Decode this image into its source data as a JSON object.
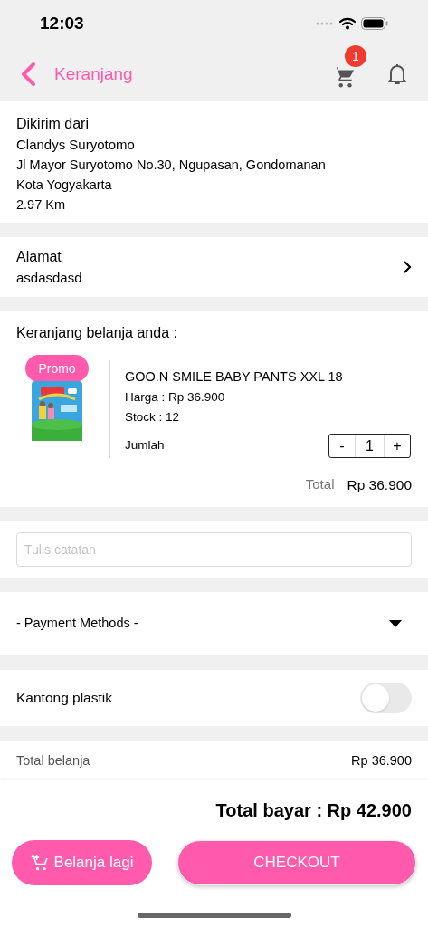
{
  "status_bar": {
    "time": "12:03"
  },
  "header": {
    "title": "Keranjang",
    "cart_badge": "1"
  },
  "sender": {
    "heading": "Dikirim dari",
    "name": "Clandys Suryotomo",
    "address": "Jl Mayor Suryotomo No.30, Ngupasan, Gondomanan",
    "city": "Kota Yogyakarta",
    "distance": "2.97 Km"
  },
  "address": {
    "heading": "Alamat",
    "value": "asdasdasd"
  },
  "cart": {
    "heading": "Keranjang belanja anda :",
    "items": [
      {
        "badge": "Promo",
        "name": "GOO.N SMILE BABY PANTS XXL 18",
        "price": "Harga : Rp 36.900",
        "stock": "Stock : 12",
        "qty_label": "Jumlah",
        "minus": "-",
        "qty": "1",
        "plus": "+"
      }
    ],
    "total_label": "Total",
    "total_value": "Rp 36.900"
  },
  "note": {
    "placeholder": "Tulis catatan"
  },
  "payment": {
    "placeholder": "- Payment Methods -"
  },
  "plastic_bag": {
    "label": "Kantong plastik",
    "on": false
  },
  "summary": [
    {
      "label": "Total belanja",
      "value": "Rp 36.900"
    }
  ],
  "footer": {
    "total": "Total bayar : Rp 42.900",
    "continue_button": "Belanja lagi",
    "checkout_button": "CHECKOUT"
  }
}
